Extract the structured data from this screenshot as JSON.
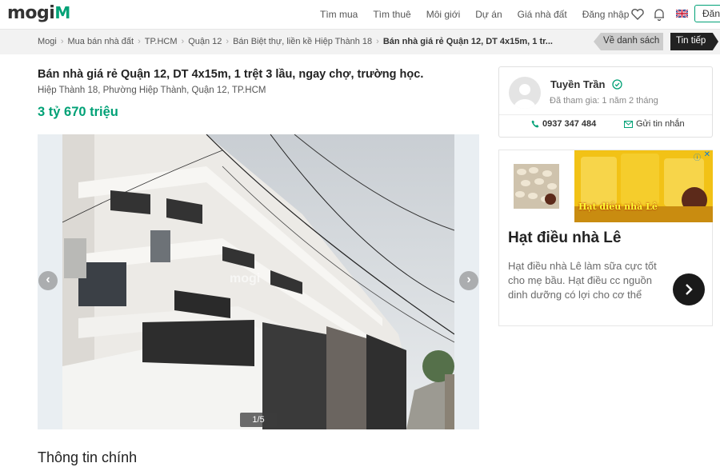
{
  "header": {
    "logo_text": "mogi",
    "logo_mark": "M",
    "nav": [
      "Tìm mua",
      "Tìm thuê",
      "Môi giới",
      "Dự án",
      "Giá nhà đất",
      "Đăng nhập"
    ],
    "register_label": "Đăng",
    "icons": [
      "heart-icon",
      "bell-icon",
      "uk-flag-icon"
    ]
  },
  "breadcrumb": {
    "items": [
      "Mogi",
      "Mua bán nhà đất",
      "TP.HCM",
      "Quận 12",
      "Bán Biệt thự, liền kề Hiệp Thành 18"
    ],
    "current": "Bán nhà giá rẻ Quận 12, DT 4x15m, 1 tr...",
    "back_label": "Về danh sách",
    "next_label": "Tin tiếp"
  },
  "listing": {
    "title": "Bán nhà giá rẻ Quận 12, DT 4x15m, 1 trệt 3 lầu, ngay chợ, trường học.",
    "address": "Hiệp Thành 18, Phường Hiệp Thành, Quận 12, TP.HCM",
    "price": "3 tỷ 670 triệu",
    "photo_counter": "1/5",
    "watermark": "mogi"
  },
  "main_info": {
    "heading": "Thông tin chính"
  },
  "agent": {
    "name": "Tuyền Trần",
    "joined": "Đã tham gia: 1 năm 2 tháng",
    "phone": "0937 347 484",
    "message_label": "Gửi tin nhắn"
  },
  "ad": {
    "image_caption": "Hạt điều nhà Lê",
    "title": "Hạt điều nhà Lê",
    "description": "Hạt điều nhà Lê làm sữa cực tốt cho mẹ bầu. Hạt điều cc nguồn dinh dưỡng có lợi cho cơ thể",
    "badge": "ⓘ",
    "close": "✕"
  },
  "colors": {
    "brand": "#00a176",
    "dark": "#222222"
  }
}
